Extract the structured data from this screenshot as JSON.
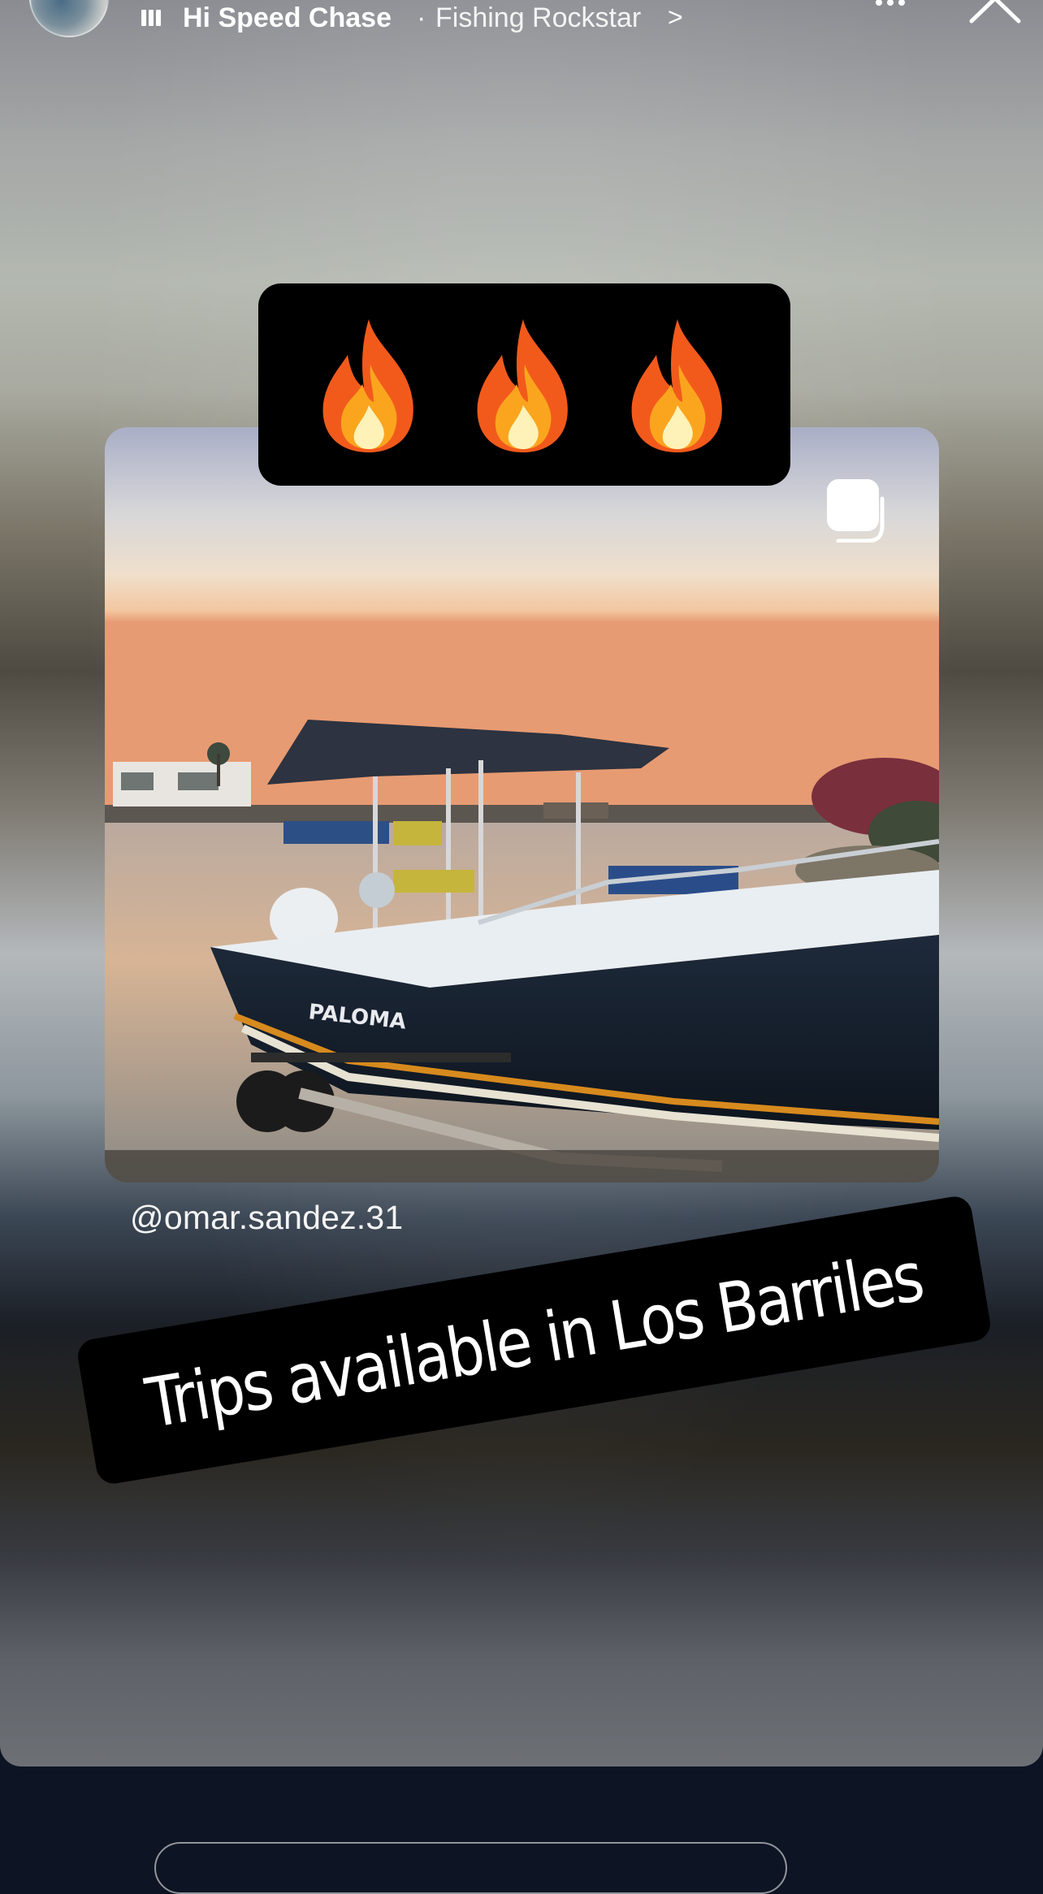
{
  "header": {
    "song_title": "Hi Speed Chase",
    "separator": "·",
    "artist": "Fishing Rockstar",
    "artist_chevron": ">"
  },
  "icons": {
    "avatar": "profile-avatar",
    "music": "music-bars-icon",
    "more": "more-dots-icon",
    "close": "close-chevron-icon",
    "gallery": "gallery-stack-icon",
    "fire": "fire-emoji"
  },
  "stickers": {
    "fire_emojis": [
      "🔥",
      "🔥",
      "🔥"
    ],
    "caption": "Trips available in Los Barriles"
  },
  "post": {
    "username": "@omar.sandez.31",
    "boat_name": "PALOMA"
  },
  "colors": {
    "sticker_bg": "#000000",
    "text": "#ffffff",
    "page_bg": "#0d1423"
  }
}
